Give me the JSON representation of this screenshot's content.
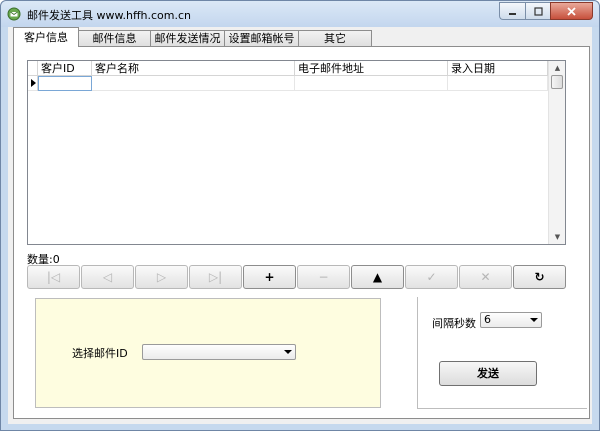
{
  "window": {
    "title": "邮件发送工具  www.hffh.com.cn"
  },
  "tabs": [
    {
      "label": "客户信息",
      "active": true
    },
    {
      "label": "邮件信息",
      "active": false
    },
    {
      "label": "邮件发送情况",
      "active": false
    },
    {
      "label": "设置邮箱帐号",
      "active": false
    },
    {
      "label": "其它",
      "active": false
    }
  ],
  "grid": {
    "columns": [
      "客户ID",
      "客户名称",
      "电子邮件地址",
      "录入日期"
    ]
  },
  "count": {
    "label": "数量:0"
  },
  "navigator": {
    "buttons": [
      {
        "icon": "first-record-icon",
        "glyph": "|◁",
        "enabled": false
      },
      {
        "icon": "prior-record-icon",
        "glyph": "◁",
        "enabled": false
      },
      {
        "icon": "next-record-icon",
        "glyph": "▷",
        "enabled": false
      },
      {
        "icon": "last-record-icon",
        "glyph": "▷|",
        "enabled": false
      },
      {
        "icon": "insert-icon",
        "glyph": "+",
        "enabled": true
      },
      {
        "icon": "delete-icon",
        "glyph": "−",
        "enabled": false
      },
      {
        "icon": "edit-icon",
        "glyph": "▲",
        "enabled": true
      },
      {
        "icon": "post-icon",
        "glyph": "✓",
        "enabled": false
      },
      {
        "icon": "cancel-icon",
        "glyph": "✕",
        "enabled": false
      },
      {
        "icon": "refresh-icon",
        "glyph": "↻",
        "enabled": true
      }
    ]
  },
  "mail_select": {
    "label": "选择邮件ID",
    "value": ""
  },
  "interval": {
    "label": "间隔秒数",
    "value": "6"
  },
  "send": {
    "label": "发送"
  }
}
